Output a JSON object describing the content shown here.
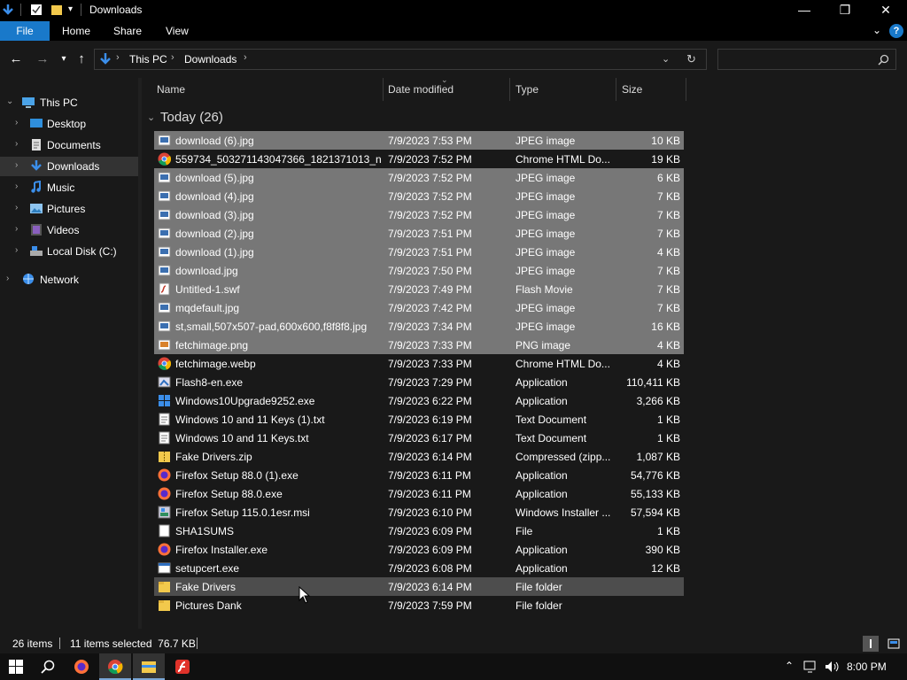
{
  "window": {
    "title": "Downloads",
    "minimize_glyph": "—",
    "maximize_glyph": "❐",
    "close_glyph": "✕"
  },
  "ribbon": {
    "tabs": [
      "File",
      "Home",
      "Share",
      "View"
    ],
    "help_glyph": "?"
  },
  "address": {
    "crumbs": [
      "This PC",
      "Downloads"
    ],
    "search_placeholder": ""
  },
  "nav": {
    "items": [
      {
        "label": "This PC",
        "icon": "pc-icon"
      },
      {
        "label": "Desktop",
        "icon": "desktop-icon"
      },
      {
        "label": "Documents",
        "icon": "documents-icon"
      },
      {
        "label": "Downloads",
        "icon": "downloads-icon"
      },
      {
        "label": "Music",
        "icon": "music-icon"
      },
      {
        "label": "Pictures",
        "icon": "pictures-icon"
      },
      {
        "label": "Videos",
        "icon": "videos-icon"
      },
      {
        "label": "Local Disk (C:)",
        "icon": "disk-icon"
      },
      {
        "label": "Network",
        "icon": "network-icon"
      }
    ]
  },
  "columns": {
    "name": "Name",
    "date": "Date modified",
    "type": "Type",
    "size": "Size"
  },
  "group": {
    "label": "Today (26)"
  },
  "files": [
    {
      "name": "download (6).jpg",
      "date": "7/9/2023 7:53 PM",
      "type": "JPEG image",
      "size": "10 KB",
      "icon": "image-icon",
      "selected": true
    },
    {
      "name": "559734_503271143047366_1821371013_n....",
      "date": "7/9/2023 7:52 PM",
      "type": "Chrome HTML Do...",
      "size": "19 KB",
      "icon": "chrome-icon",
      "selected": false
    },
    {
      "name": "download (5).jpg",
      "date": "7/9/2023 7:52 PM",
      "type": "JPEG image",
      "size": "6 KB",
      "icon": "image-icon",
      "selected": true
    },
    {
      "name": "download (4).jpg",
      "date": "7/9/2023 7:52 PM",
      "type": "JPEG image",
      "size": "7 KB",
      "icon": "image-icon",
      "selected": true
    },
    {
      "name": "download (3).jpg",
      "date": "7/9/2023 7:52 PM",
      "type": "JPEG image",
      "size": "7 KB",
      "icon": "image-icon",
      "selected": true
    },
    {
      "name": "download (2).jpg",
      "date": "7/9/2023 7:51 PM",
      "type": "JPEG image",
      "size": "7 KB",
      "icon": "image-icon",
      "selected": true
    },
    {
      "name": "download (1).jpg",
      "date": "7/9/2023 7:51 PM",
      "type": "JPEG image",
      "size": "4 KB",
      "icon": "image-icon",
      "selected": true
    },
    {
      "name": "download.jpg",
      "date": "7/9/2023 7:50 PM",
      "type": "JPEG image",
      "size": "7 KB",
      "icon": "image-icon",
      "selected": true
    },
    {
      "name": "Untitled-1.swf",
      "date": "7/9/2023 7:49 PM",
      "type": "Flash Movie",
      "size": "7 KB",
      "icon": "flash-file-icon",
      "selected": true
    },
    {
      "name": "mqdefault.jpg",
      "date": "7/9/2023 7:42 PM",
      "type": "JPEG image",
      "size": "7 KB",
      "icon": "image-icon",
      "selected": true
    },
    {
      "name": "st,small,507x507-pad,600x600,f8f8f8.jpg",
      "date": "7/9/2023 7:34 PM",
      "type": "JPEG image",
      "size": "16 KB",
      "icon": "image-icon",
      "selected": true
    },
    {
      "name": "fetchimage.png",
      "date": "7/9/2023 7:33 PM",
      "type": "PNG image",
      "size": "4 KB",
      "icon": "png-icon",
      "selected": true
    },
    {
      "name": "fetchimage.webp",
      "date": "7/9/2023 7:33 PM",
      "type": "Chrome HTML Do...",
      "size": "4 KB",
      "icon": "chrome-icon",
      "selected": false
    },
    {
      "name": "Flash8-en.exe",
      "date": "7/9/2023 7:29 PM",
      "type": "Application",
      "size": "110,411 KB",
      "icon": "installer-icon",
      "selected": false
    },
    {
      "name": "Windows10Upgrade9252.exe",
      "date": "7/9/2023 6:22 PM",
      "type": "Application",
      "size": "3,266 KB",
      "icon": "windows-icon",
      "selected": false
    },
    {
      "name": "Windows 10 and 11 Keys (1).txt",
      "date": "7/9/2023 6:19 PM",
      "type": "Text Document",
      "size": "1 KB",
      "icon": "text-file-icon",
      "selected": false
    },
    {
      "name": "Windows 10 and 11 Keys.txt",
      "date": "7/9/2023 6:17 PM",
      "type": "Text Document",
      "size": "1 KB",
      "icon": "text-file-icon",
      "selected": false
    },
    {
      "name": "Fake Drivers.zip",
      "date": "7/9/2023 6:14 PM",
      "type": "Compressed (zipp...",
      "size": "1,087 KB",
      "icon": "zip-icon",
      "selected": false
    },
    {
      "name": "Firefox Setup 88.0 (1).exe",
      "date": "7/9/2023 6:11 PM",
      "type": "Application",
      "size": "54,776 KB",
      "icon": "firefox-icon",
      "selected": false
    },
    {
      "name": "Firefox Setup 88.0.exe",
      "date": "7/9/2023 6:11 PM",
      "type": "Application",
      "size": "55,133 KB",
      "icon": "firefox-icon",
      "selected": false
    },
    {
      "name": "Firefox Setup 115.0.1esr.msi",
      "date": "7/9/2023 6:10 PM",
      "type": "Windows Installer ...",
      "size": "57,594 KB",
      "icon": "msi-icon",
      "selected": false
    },
    {
      "name": "SHA1SUMS",
      "date": "7/9/2023 6:09 PM",
      "type": "File",
      "size": "1 KB",
      "icon": "blank-file-icon",
      "selected": false
    },
    {
      "name": "Firefox Installer.exe",
      "date": "7/9/2023 6:09 PM",
      "type": "Application",
      "size": "390 KB",
      "icon": "firefox-icon",
      "selected": false
    },
    {
      "name": "setupcert.exe",
      "date": "7/9/2023 6:08 PM",
      "type": "Application",
      "size": "12 KB",
      "icon": "app-window-icon",
      "selected": false
    },
    {
      "name": "Fake Drivers",
      "date": "7/9/2023 6:14 PM",
      "type": "File folder",
      "size": "",
      "icon": "folder-icon",
      "selected": false,
      "hover": true
    },
    {
      "name": "Pictures Dank",
      "date": "7/9/2023 7:59 PM",
      "type": "File folder",
      "size": "",
      "icon": "folder-icon",
      "selected": false
    }
  ],
  "status": {
    "count": "26 items",
    "selected": "11 items selected  76.7 KB"
  },
  "taskbar": {
    "clock": "8:00 PM"
  },
  "colors": {
    "accent": "#1979ca",
    "selected_row": "#777777",
    "folder": "#f2c94c"
  }
}
